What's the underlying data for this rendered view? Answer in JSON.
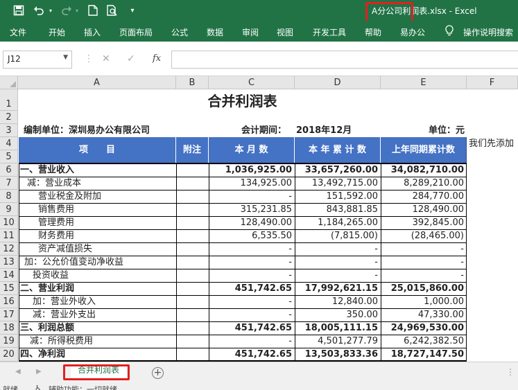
{
  "titlebar": {
    "doc_title": "A分公司利润表.xlsx  -  Excel",
    "icons": [
      "save-icon",
      "undo-icon",
      "undo-dropdown-icon",
      "redo-icon",
      "redo-dropdown-icon",
      "new-file-icon",
      "print-preview-icon",
      "customize-quick-access-icon"
    ]
  },
  "ribbon": {
    "tabs": [
      "文件",
      "开始",
      "插入",
      "页面布局",
      "公式",
      "数据",
      "审阅",
      "视图",
      "开发工具",
      "帮助",
      "易办公"
    ],
    "tell_me": "操作说明搜索"
  },
  "formula_bar": {
    "name_box": "J12",
    "cancel": "✕",
    "enter": "✓",
    "fx": "fx",
    "content": ""
  },
  "columns": [
    "A",
    "B",
    "C",
    "D",
    "E",
    "F"
  ],
  "rows": [
    "1",
    "2",
    "3",
    "4",
    "5",
    "6",
    "7",
    "8",
    "9",
    "10",
    "11",
    "12",
    "13",
    "14",
    "15",
    "16",
    "17",
    "18",
    "19",
    "20"
  ],
  "report": {
    "title": "合并利润表",
    "unit_label": "编制单位：深圳易办公有限公司",
    "period_label": "会计期间：",
    "period_value": "2018年12月",
    "currency_label": "单位：元",
    "side_note": "我们先添加",
    "headers": [
      "项　　目",
      "附注",
      "本 月 数",
      "本 年 累 计 数",
      "上年同期累计数"
    ],
    "lines": [
      {
        "item": "一、营业收入",
        "note": "",
        "month": "1,036,925.00",
        "ytd": "33,657,260.00",
        "prior": "34,082,710.00"
      },
      {
        "item": "减：营业成本",
        "note": "",
        "month": "134,925.00",
        "ytd": "13,492,715.00",
        "prior": "8,289,210.00"
      },
      {
        "item": "营业税金及附加",
        "note": "",
        "month": "-",
        "ytd": "151,592.00",
        "prior": "284,770.00"
      },
      {
        "item": "销售费用",
        "note": "",
        "month": "315,231.85",
        "ytd": "843,881.85",
        "prior": "128,490.00"
      },
      {
        "item": "管理费用",
        "note": "",
        "month": "128,490.00",
        "ytd": "1,184,265.00",
        "prior": "392,845.00"
      },
      {
        "item": "财务费用",
        "note": "",
        "month": "6,535.50",
        "ytd": "(7,815.00)",
        "prior": "(28,465.00)"
      },
      {
        "item": "资产减值损失",
        "note": "",
        "month": "-",
        "ytd": "-",
        "prior": "-"
      },
      {
        "item": "加：公允价值变动净收益",
        "note": "",
        "month": "-",
        "ytd": "-",
        "prior": "-"
      },
      {
        "item": "投资收益",
        "note": "",
        "month": "-",
        "ytd": "-",
        "prior": "-"
      },
      {
        "item": "二、营业利润",
        "note": "",
        "month": "451,742.65",
        "ytd": "17,992,621.15",
        "prior": "25,015,860.00"
      },
      {
        "item": "加：营业外收入",
        "note": "",
        "month": "-",
        "ytd": "12,840.00",
        "prior": "1,000.00"
      },
      {
        "item": "减：营业外支出",
        "note": "",
        "month": "-",
        "ytd": "350.00",
        "prior": "47,330.00"
      },
      {
        "item": "三、利润总额",
        "note": "",
        "month": "451,742.65",
        "ytd": "18,005,111.15",
        "prior": "24,969,530.00"
      },
      {
        "item": "减：所得税费用",
        "note": "",
        "month": "-",
        "ytd": "4,501,277.79",
        "prior": "6,242,382.50"
      },
      {
        "item": "四、净利润",
        "note": "",
        "month": "451,742.65",
        "ytd": "13,503,833.36",
        "prior": "18,727,147.50"
      }
    ]
  },
  "sheet_tabs": {
    "active": "合并利润表",
    "add": "+"
  },
  "status": {
    "ready": "就绪",
    "accessibility": "辅助功能：一切就绪"
  }
}
